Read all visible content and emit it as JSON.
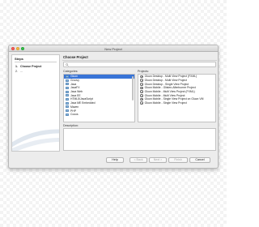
{
  "window": {
    "title": "New Project"
  },
  "steps": {
    "heading": "Steps",
    "items": [
      {
        "num": "1.",
        "label": "Choose Project"
      },
      {
        "num": "2.",
        "label": "..."
      }
    ]
  },
  "main": {
    "title": "Choose Project",
    "search_placeholder": "",
    "categories_label": "Categories:",
    "projects_label": "Projects:",
    "description_label": "Description:",
    "categories": [
      {
        "label": "Gluon",
        "selected": true
      },
      {
        "label": "Groovy"
      },
      {
        "label": "Java"
      },
      {
        "label": "JavaFX"
      },
      {
        "label": "Java Web"
      },
      {
        "label": "Java EE"
      },
      {
        "label": "HTML5/JavaScript"
      },
      {
        "label": "Java ME Embedded"
      },
      {
        "label": "Maven"
      },
      {
        "label": "PHP"
      },
      {
        "label": "Cocos"
      }
    ],
    "projects": [
      {
        "label": "Gluon Desktop - Multi View Project (FXML)"
      },
      {
        "label": "Gluon Desktop - Multi View Project"
      },
      {
        "label": "Gluon Desktop - Single View Project"
      },
      {
        "label": "Gluon Mobile - Glisten-Afterburner Project"
      },
      {
        "label": "Gluon Mobile - Multi View Project (FXML)"
      },
      {
        "label": "Gluon Mobile - Multi View Project"
      },
      {
        "label": "Gluon Mobile - Single View Project on Gluon VM"
      },
      {
        "label": "Gluon Mobile - Single View Project"
      }
    ]
  },
  "buttons": {
    "help": "Help",
    "back": "< Back",
    "next": "Next >",
    "finish": "Finish",
    "cancel": "Cancel"
  },
  "colors": {
    "selection": "#3874d7",
    "window_bg": "#ececec",
    "close": "#fc605c",
    "minimize": "#fdbc40",
    "zoom": "#34c84a"
  }
}
